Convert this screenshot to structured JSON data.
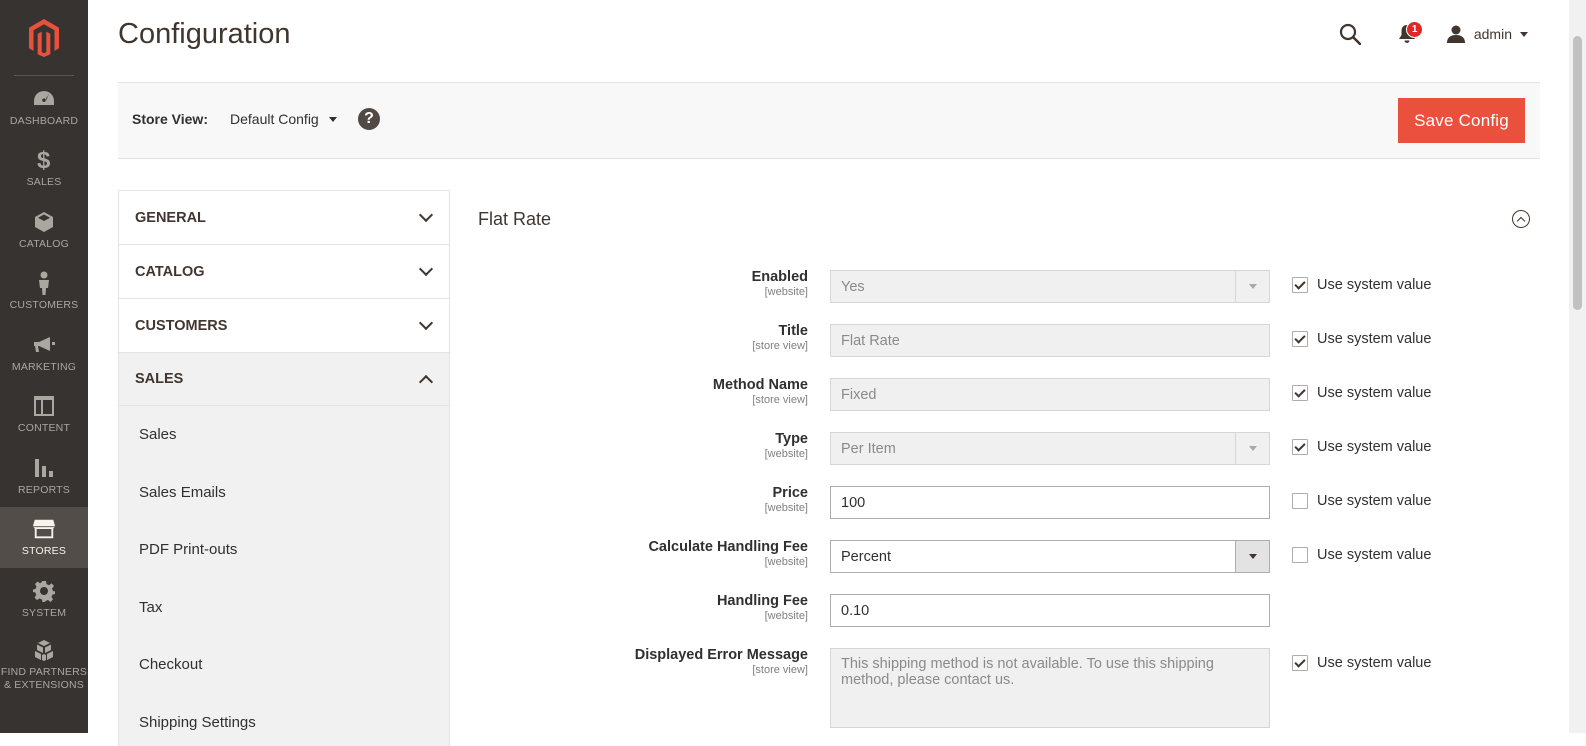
{
  "nav": {
    "items": [
      {
        "label": "DASHBOARD",
        "icon": "dashboard-icon"
      },
      {
        "label": "SALES",
        "icon": "dollar-icon"
      },
      {
        "label": "CATALOG",
        "icon": "cube-icon"
      },
      {
        "label": "CUSTOMERS",
        "icon": "person-icon"
      },
      {
        "label": "MARKETING",
        "icon": "megaphone-icon"
      },
      {
        "label": "CONTENT",
        "icon": "layout-icon"
      },
      {
        "label": "REPORTS",
        "icon": "bar-chart-icon"
      },
      {
        "label": "STORES",
        "icon": "storefront-icon"
      },
      {
        "label": "SYSTEM",
        "icon": "gear-icon"
      },
      {
        "label": "FIND PARTNERS & EXTENSIONS",
        "icon": "boxes-icon"
      }
    ],
    "active": "STORES"
  },
  "header": {
    "title": "Configuration",
    "notification_count": "1",
    "user": "admin"
  },
  "store_bar": {
    "label": "Store View:",
    "selected": "Default Config",
    "help": "?",
    "save_label": "Save Config"
  },
  "config_tabs": {
    "groups": [
      {
        "label": "GENERAL"
      },
      {
        "label": "CATALOG"
      },
      {
        "label": "CUSTOMERS"
      },
      {
        "label": "SALES"
      }
    ],
    "sales_items": [
      "Sales",
      "Sales Emails",
      "PDF Print-outs",
      "Tax",
      "Checkout",
      "Shipping Settings"
    ]
  },
  "section": {
    "title": "Flat Rate",
    "use_system_label": "Use system value",
    "fields": [
      {
        "label": "Enabled",
        "scope": "[website]",
        "value": "Yes",
        "type": "select",
        "disabled": true,
        "use_system": true
      },
      {
        "label": "Title",
        "scope": "[store view]",
        "value": "Flat Rate",
        "type": "text",
        "disabled": true,
        "use_system": true
      },
      {
        "label": "Method Name",
        "scope": "[store view]",
        "value": "Fixed",
        "type": "text",
        "disabled": true,
        "use_system": true
      },
      {
        "label": "Type",
        "scope": "[website]",
        "value": "Per Item",
        "type": "select",
        "disabled": true,
        "use_system": true
      },
      {
        "label": "Price",
        "scope": "[website]",
        "value": "100",
        "type": "text",
        "disabled": false,
        "use_system": false
      },
      {
        "label": "Calculate Handling Fee",
        "scope": "[website]",
        "value": "Percent",
        "type": "select",
        "disabled": false,
        "use_system": false
      },
      {
        "label": "Handling Fee",
        "scope": "[website]",
        "value": "0.10",
        "type": "text",
        "disabled": false
      },
      {
        "label": "Displayed Error Message",
        "scope": "[store view]",
        "value": "This shipping method is not available. To use this shipping method, please contact us.",
        "type": "textarea",
        "disabled": true,
        "use_system": true
      }
    ]
  },
  "colors": {
    "nav_bg": "#373330",
    "nav_active": "#524d49",
    "primary_button": "#e9513c",
    "logo": "#e9513c",
    "badge": "#e22626"
  }
}
